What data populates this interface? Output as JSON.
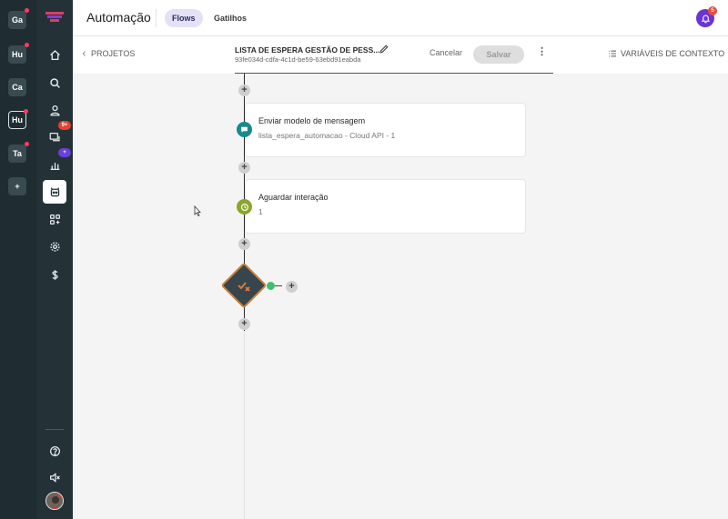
{
  "workspaces": [
    {
      "label": "Ga",
      "dot": true
    },
    {
      "label": "Hu",
      "dot": true
    },
    {
      "label": "Ca",
      "dot": false
    },
    {
      "label": "Hu",
      "dot": true,
      "active": true
    },
    {
      "label": "Ta",
      "dot": true
    },
    {
      "label": "+",
      "dot": false
    }
  ],
  "sidebar": {
    "logo": "brand-logo",
    "nav": [
      {
        "name": "home-icon"
      },
      {
        "name": "search-icon"
      },
      {
        "name": "contacts-icon"
      },
      {
        "name": "chat-icon",
        "badge": "9+",
        "badge_color": "#e6432f"
      },
      {
        "name": "reports-icon",
        "badge": "+",
        "badge_color": "#6b3fd9"
      },
      {
        "name": "bot-icon",
        "active": true
      },
      {
        "name": "apps-icon"
      },
      {
        "name": "settings-icon"
      },
      {
        "name": "billing-icon"
      }
    ],
    "bottom": [
      {
        "name": "help-icon"
      },
      {
        "name": "mute-icon"
      }
    ]
  },
  "header": {
    "title": "Automação",
    "tabs": [
      {
        "label": "Flows",
        "active": true
      },
      {
        "label": "Gatilhos",
        "active": false
      }
    ],
    "notifications": "5"
  },
  "subheader": {
    "back_label": "PROJETOS",
    "flow_name": "LISTA DE ESPERA GESTÃO DE PESS...",
    "flow_id": "93fe034d-cdfa-4c1d-be59-63ebd91eabda",
    "cancel_label": "Cancelar",
    "save_label": "Salvar",
    "more_label": "⋮",
    "context_label": "VARIÁVEIS DE CONTEXTO"
  },
  "flow": {
    "nodes": [
      {
        "title": "Enviar modelo de mensagem",
        "subtitle": "lista_espera_automacao - Cloud API - 1",
        "icon": "message-icon",
        "color": "#1a8a8a"
      },
      {
        "title": "Aguardar interação",
        "subtitle": "1",
        "icon": "clock-icon",
        "color": "#8aa62a"
      }
    ],
    "condition_icon": "condition-icon"
  },
  "colors": {
    "accent": "#6a35d4",
    "sidebar": "#243238",
    "rail": "#1f2d33"
  }
}
